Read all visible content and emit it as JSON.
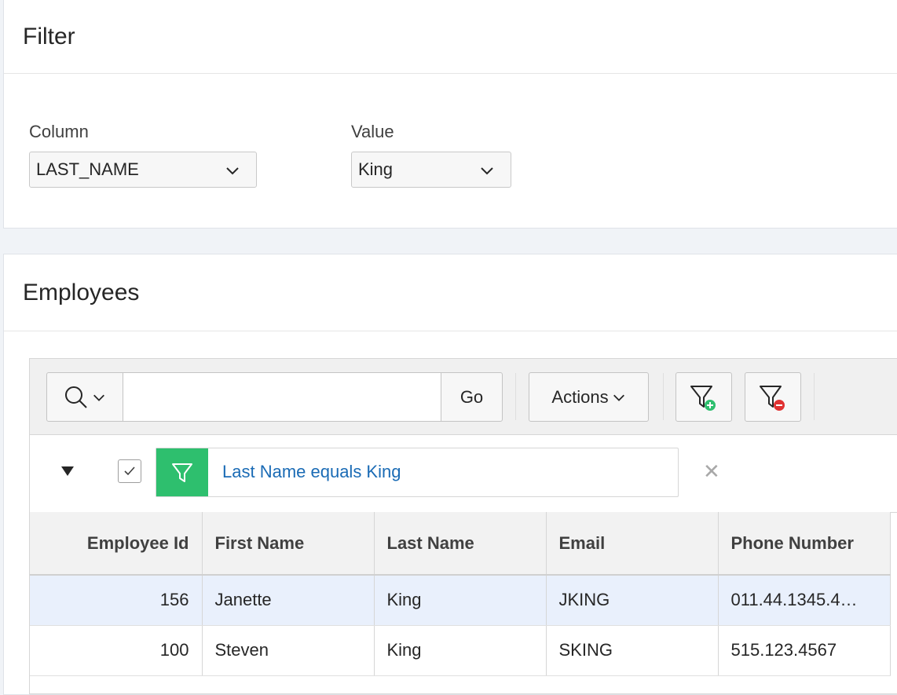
{
  "filter_region": {
    "title": "Filter",
    "column_label": "Column",
    "column_value": "LAST_NAME",
    "value_label": "Value",
    "value_value": "King"
  },
  "employees_region": {
    "title": "Employees",
    "toolbar": {
      "search_icon": "search-icon",
      "search_value": "",
      "go_label": "Go",
      "actions_label": "Actions"
    },
    "filter": {
      "enabled": true,
      "text": "Last Name equals King",
      "remove_symbol": "✕"
    },
    "table": {
      "headers": [
        "Employee Id",
        "First Name",
        "Last Name",
        "Email",
        "Phone Number"
      ],
      "rows": [
        [
          "156",
          "Janette",
          "King",
          "JKING",
          "011.44.1345.4…"
        ],
        [
          "100",
          "Steven",
          "King",
          "SKING",
          "515.123.4567"
        ]
      ],
      "selected_row": 0
    }
  },
  "colors": {
    "filter_icon_bg": "#2ebf6e",
    "filter_link": "#1a6bb5",
    "selected_row": "#e9f0fc",
    "add_filter_badge": "#2ebf6e",
    "remove_filter_badge": "#e03131"
  }
}
